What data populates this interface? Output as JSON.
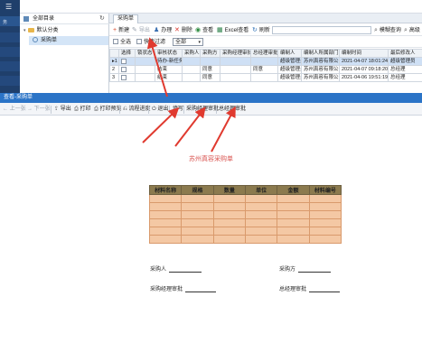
{
  "rail": {
    "items": [
      "务",
      "",
      "",
      "",
      "",
      ""
    ]
  },
  "tree": {
    "title": "全部目录",
    "nodes": [
      {
        "label": "默认分类"
      },
      {
        "label": "采购单"
      }
    ]
  },
  "list_panel": {
    "tab_label": "采购单",
    "toolbar": {
      "new": "新建",
      "export": "导出",
      "handle": "办理",
      "delete": "删除",
      "view": "查看",
      "excel": "Excel查看",
      "refresh": "刷新",
      "fuzzy": "模糊查询",
      "advanced": "高级"
    },
    "filter": {
      "select_all": "全选",
      "quick_filter": "快速过滤",
      "status_value": "全部"
    },
    "columns": [
      "",
      "选择",
      "锁状态",
      "审核状态",
      "采购人",
      "采购方",
      "采购经理审批",
      "总经理审批",
      "编制人",
      "编制人所属部门",
      "编制时间",
      "最后修改人"
    ],
    "rows": [
      [
        "▸1",
        "",
        "",
        "待办-新任务",
        "",
        "",
        "",
        "",
        "超级管理员",
        "苏州真容有限公",
        "2021-04-07 18:01:24",
        "超级管理员"
      ],
      [
        "2",
        "",
        "",
        "结束",
        "",
        "同意",
        "",
        "同意",
        "超级管理员",
        "苏州真容有限公",
        "2021-04-07 09:18:20",
        "总经理"
      ],
      [
        "3",
        "",
        "",
        "结束",
        "",
        "同意",
        "",
        "",
        "超级管理员",
        "苏州真容有限公",
        "2021-04-06 19:51:19",
        "总经理"
      ]
    ]
  },
  "doc_window": {
    "title": "查看-采购单",
    "toolbar": {
      "prev": "上一张",
      "next": "下一张",
      "export": "导出",
      "print": "打印",
      "print_preview": "打印预览",
      "progress": "流程进度",
      "exit": "退出",
      "fill": "填写",
      "purchase_manager": "采购经理审批",
      "general_manager": "总经理审批"
    },
    "doc_title": "苏州真容采购单",
    "table_headers": [
      "材料名称",
      "规格",
      "数量",
      "单位",
      "金额",
      "材料编号"
    ],
    "empty_rows": 6,
    "signatures": {
      "buyer": "采购人",
      "purchaser_party": "采购方",
      "purchase_manager": "采购经理审批",
      "general_manager": "总经理审批"
    }
  },
  "colors": {
    "annotation_arrow": "#e03a2f",
    "title_bar": "#2b74c7",
    "table_header": "#8b7a4e",
    "table_cell": "#f4c8a4"
  }
}
